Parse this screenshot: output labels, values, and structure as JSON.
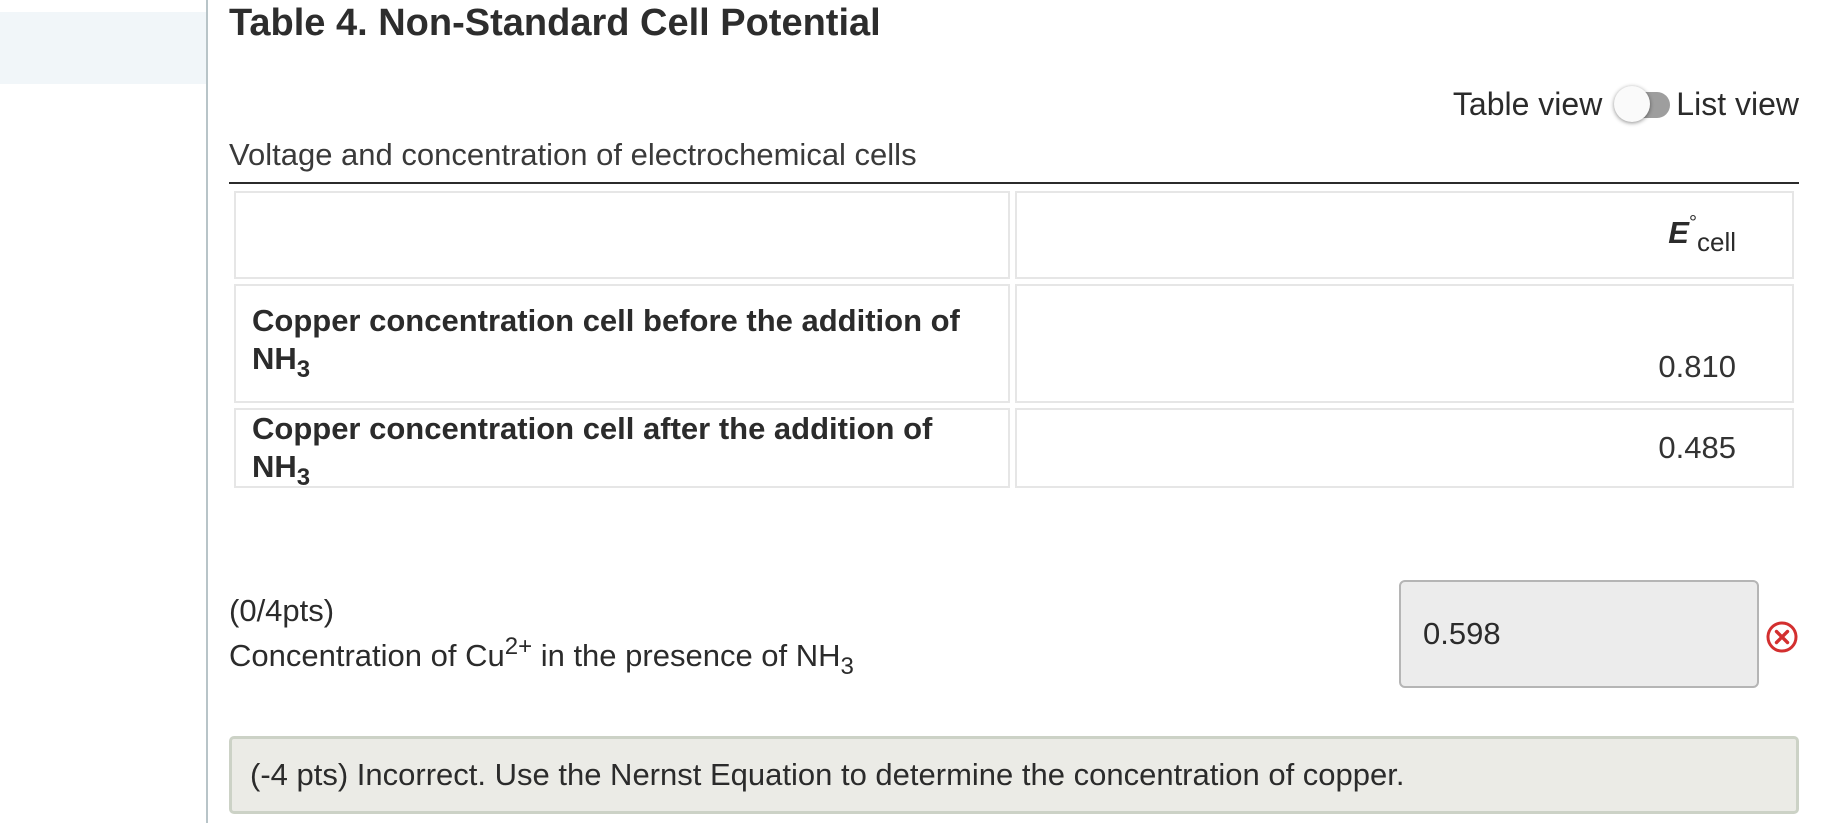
{
  "table": {
    "title": "Table 4. Non-Standard Cell Potential",
    "caption": "Voltage and concentration of electrochemical cells",
    "column_header": {
      "symbol": "E",
      "degree": "°",
      "subscript": "cell"
    },
    "rows": [
      {
        "label_prefix": "Copper concentration cell before the addition of NH",
        "label_sub": "3",
        "value": "0.810"
      },
      {
        "label_prefix": "Copper concentration cell after the addition of NH",
        "label_sub": "3",
        "value": "0.485"
      }
    ]
  },
  "view_toggle": {
    "left_label": "Table view",
    "right_label": "List view",
    "selected": "Table view"
  },
  "question": {
    "points": "(0/4pts)",
    "text_prefix": "Concentration of Cu",
    "text_sup": "2+",
    "text_middle": " in the presence of NH",
    "text_sub": "3",
    "answer_value": "0.598",
    "status_icon": "incorrect-circle-x-icon",
    "status_color": "#d32f2f"
  },
  "feedback": {
    "text": "(-4 pts) Incorrect. Use the Nernst Equation to determine the concentration of copper."
  },
  "colors": {
    "sidebar_highlight": "#f1f6f9",
    "input_background": "#ececec",
    "feedback_background": "#ebebe6",
    "toggle_track": "#9e9e9e"
  }
}
